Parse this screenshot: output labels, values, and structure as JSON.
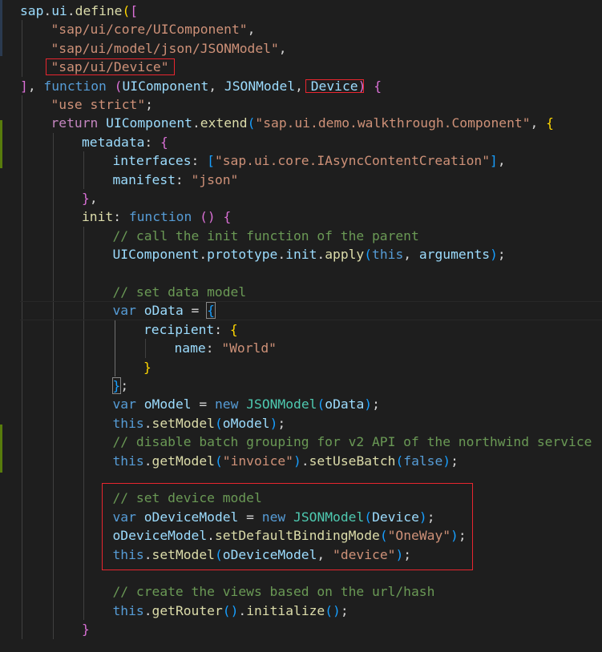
{
  "editor": {
    "language": "javascript",
    "theme_colors": {
      "background": "#1e1e1e",
      "default_text": "#d4d4d4",
      "variable": "#9cdcfe",
      "function": "#dcdcaa",
      "string": "#ce9178",
      "keyword": "#569cd6",
      "control": "#c586c0",
      "class": "#4ec9b0",
      "comment": "#6a9955",
      "bracket_level_1": "#ffd700",
      "bracket_level_2": "#da70d6",
      "bracket_level_3": "#179fff",
      "annotation_box": "#e8262f",
      "diff_added_bar": "#587c0c"
    },
    "lines": [
      {
        "indent": 0,
        "tokens": [
          [
            "var",
            "sap"
          ],
          [
            "default",
            "."
          ],
          [
            "var",
            "ui"
          ],
          [
            "default",
            "."
          ],
          [
            "fn",
            "define"
          ],
          [
            "b1",
            "("
          ],
          [
            "b2",
            "["
          ]
        ]
      },
      {
        "indent": 1,
        "tokens": [
          [
            "str",
            "\"sap/ui/core/UIComponent\""
          ],
          [
            "default",
            ","
          ]
        ]
      },
      {
        "indent": 1,
        "tokens": [
          [
            "str",
            "\"sap/ui/model/json/JSONModel\""
          ],
          [
            "default",
            ","
          ]
        ]
      },
      {
        "indent": 1,
        "tokens": [
          [
            "str",
            "\"sap/ui/Device\""
          ]
        ]
      },
      {
        "indent": 0,
        "tokens": [
          [
            "b2",
            "]"
          ],
          [
            "default",
            ", "
          ],
          [
            "kw",
            "function"
          ],
          [
            "default",
            " "
          ],
          [
            "b2",
            "("
          ],
          [
            "var",
            "UIComponent"
          ],
          [
            "default",
            ", "
          ],
          [
            "var",
            "JSONModel"
          ],
          [
            "default",
            ", "
          ],
          [
            "var",
            "Device"
          ],
          [
            "b2",
            ")"
          ],
          [
            "default",
            " "
          ],
          [
            "b2",
            "{"
          ]
        ]
      },
      {
        "indent": 1,
        "tokens": [
          [
            "str",
            "\"use strict\""
          ],
          [
            "default",
            ";"
          ]
        ]
      },
      {
        "indent": 1,
        "tokens": [
          [
            "ctrl",
            "return"
          ],
          [
            "default",
            " "
          ],
          [
            "var",
            "UIComponent"
          ],
          [
            "default",
            "."
          ],
          [
            "fn",
            "extend"
          ],
          [
            "b3",
            "("
          ],
          [
            "str",
            "\"sap.ui.demo.walkthrough.Component\""
          ],
          [
            "default",
            ", "
          ],
          [
            "b1",
            "{"
          ]
        ]
      },
      {
        "indent": 2,
        "tokens": [
          [
            "var",
            "metadata"
          ],
          [
            "default",
            ": "
          ],
          [
            "b2",
            "{"
          ]
        ]
      },
      {
        "indent": 3,
        "tokens": [
          [
            "var",
            "interfaces"
          ],
          [
            "default",
            ": "
          ],
          [
            "b3",
            "["
          ],
          [
            "str",
            "\"sap.ui.core.IAsyncContentCreation\""
          ],
          [
            "b3",
            "]"
          ],
          [
            "default",
            ","
          ]
        ]
      },
      {
        "indent": 3,
        "tokens": [
          [
            "var",
            "manifest"
          ],
          [
            "default",
            ": "
          ],
          [
            "str",
            "\"json\""
          ]
        ]
      },
      {
        "indent": 2,
        "tokens": [
          [
            "b2",
            "}"
          ],
          [
            "default",
            ","
          ]
        ]
      },
      {
        "indent": 2,
        "tokens": [
          [
            "fn",
            "init"
          ],
          [
            "default",
            ": "
          ],
          [
            "kw",
            "function"
          ],
          [
            "default",
            " "
          ],
          [
            "b2",
            "("
          ],
          [
            "b2",
            ")"
          ],
          [
            "default",
            " "
          ],
          [
            "b2",
            "{"
          ]
        ]
      },
      {
        "indent": 3,
        "tokens": [
          [
            "cmt",
            "// call the init function of the parent"
          ]
        ]
      },
      {
        "indent": 3,
        "tokens": [
          [
            "var",
            "UIComponent"
          ],
          [
            "default",
            "."
          ],
          [
            "var",
            "prototype"
          ],
          [
            "default",
            "."
          ],
          [
            "var",
            "init"
          ],
          [
            "default",
            "."
          ],
          [
            "fn",
            "apply"
          ],
          [
            "b3",
            "("
          ],
          [
            "kw",
            "this"
          ],
          [
            "default",
            ", "
          ],
          [
            "var",
            "arguments"
          ],
          [
            "b3",
            ")"
          ],
          [
            "default",
            ";"
          ]
        ]
      },
      {
        "indent": 0,
        "tokens": []
      },
      {
        "indent": 3,
        "tokens": [
          [
            "cmt",
            "// set data model"
          ]
        ]
      },
      {
        "indent": 3,
        "tokens": [
          [
            "kw",
            "var"
          ],
          [
            "default",
            " "
          ],
          [
            "var",
            "oData"
          ],
          [
            "default",
            " = "
          ],
          [
            "b3",
            "{"
          ]
        ]
      },
      {
        "indent": 4,
        "tokens": [
          [
            "var",
            "recipient"
          ],
          [
            "default",
            ": "
          ],
          [
            "b1",
            "{"
          ]
        ]
      },
      {
        "indent": 5,
        "tokens": [
          [
            "var",
            "name"
          ],
          [
            "default",
            ": "
          ],
          [
            "str",
            "\"World\""
          ]
        ]
      },
      {
        "indent": 4,
        "tokens": [
          [
            "b1",
            "}"
          ]
        ]
      },
      {
        "indent": 3,
        "tokens": [
          [
            "b3",
            "}"
          ],
          [
            "default",
            ";"
          ]
        ]
      },
      {
        "indent": 3,
        "tokens": [
          [
            "kw",
            "var"
          ],
          [
            "default",
            " "
          ],
          [
            "var",
            "oModel"
          ],
          [
            "default",
            " = "
          ],
          [
            "kw",
            "new"
          ],
          [
            "default",
            " "
          ],
          [
            "cls",
            "JSONModel"
          ],
          [
            "b3",
            "("
          ],
          [
            "var",
            "oData"
          ],
          [
            "b3",
            ")"
          ],
          [
            "default",
            ";"
          ]
        ]
      },
      {
        "indent": 3,
        "tokens": [
          [
            "kw",
            "this"
          ],
          [
            "default",
            "."
          ],
          [
            "fn",
            "setModel"
          ],
          [
            "b3",
            "("
          ],
          [
            "var",
            "oModel"
          ],
          [
            "b3",
            ")"
          ],
          [
            "default",
            ";"
          ]
        ]
      },
      {
        "indent": 3,
        "tokens": [
          [
            "cmt",
            "// disable batch grouping for v2 API of the northwind service"
          ]
        ]
      },
      {
        "indent": 3,
        "tokens": [
          [
            "kw",
            "this"
          ],
          [
            "default",
            "."
          ],
          [
            "fn",
            "getModel"
          ],
          [
            "b3",
            "("
          ],
          [
            "str",
            "\"invoice\""
          ],
          [
            "b3",
            ")"
          ],
          [
            "default",
            "."
          ],
          [
            "fn",
            "setUseBatch"
          ],
          [
            "b3",
            "("
          ],
          [
            "kw",
            "false"
          ],
          [
            "b3",
            ")"
          ],
          [
            "default",
            ";"
          ]
        ]
      },
      {
        "indent": 0,
        "tokens": []
      },
      {
        "indent": 3,
        "tokens": [
          [
            "cmt",
            "// set device model"
          ]
        ]
      },
      {
        "indent": 3,
        "tokens": [
          [
            "kw",
            "var"
          ],
          [
            "default",
            " "
          ],
          [
            "var",
            "oDeviceModel"
          ],
          [
            "default",
            " = "
          ],
          [
            "kw",
            "new"
          ],
          [
            "default",
            " "
          ],
          [
            "cls",
            "JSONModel"
          ],
          [
            "b3",
            "("
          ],
          [
            "var",
            "Device"
          ],
          [
            "b3",
            ")"
          ],
          [
            "default",
            ";"
          ]
        ]
      },
      {
        "indent": 3,
        "tokens": [
          [
            "var",
            "oDeviceModel"
          ],
          [
            "default",
            "."
          ],
          [
            "fn",
            "setDefaultBindingMode"
          ],
          [
            "b3",
            "("
          ],
          [
            "str",
            "\"OneWay\""
          ],
          [
            "b3",
            ")"
          ],
          [
            "default",
            ";"
          ]
        ]
      },
      {
        "indent": 3,
        "tokens": [
          [
            "kw",
            "this"
          ],
          [
            "default",
            "."
          ],
          [
            "fn",
            "setModel"
          ],
          [
            "b3",
            "("
          ],
          [
            "var",
            "oDeviceModel"
          ],
          [
            "default",
            ", "
          ],
          [
            "str",
            "\"device\""
          ],
          [
            "b3",
            ")"
          ],
          [
            "default",
            ";"
          ]
        ]
      },
      {
        "indent": 0,
        "tokens": []
      },
      {
        "indent": 3,
        "tokens": [
          [
            "cmt",
            "// create the views based on the url/hash"
          ]
        ]
      },
      {
        "indent": 3,
        "tokens": [
          [
            "kw",
            "this"
          ],
          [
            "default",
            "."
          ],
          [
            "fn",
            "getRouter"
          ],
          [
            "b3",
            "("
          ],
          [
            "b3",
            ")"
          ],
          [
            "default",
            "."
          ],
          [
            "fn",
            "initialize"
          ],
          [
            "b3",
            "("
          ],
          [
            "b3",
            ")"
          ],
          [
            "default",
            ";"
          ]
        ]
      },
      {
        "indent": 2,
        "tokens": [
          [
            "b2",
            "}"
          ]
        ]
      }
    ]
  }
}
